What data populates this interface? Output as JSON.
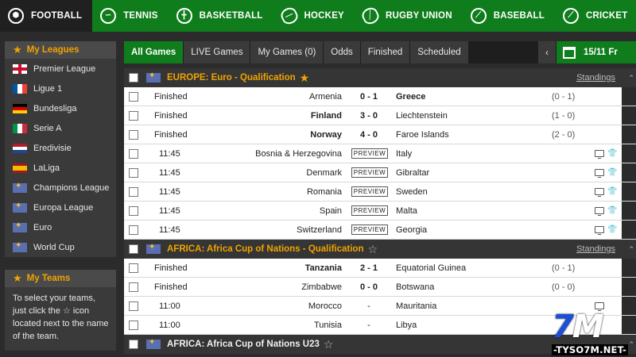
{
  "topnav": {
    "sports": [
      {
        "label": "FOOTBALL",
        "icon": "football-icon",
        "active": true
      },
      {
        "label": "TENNIS",
        "icon": "tennis-icon"
      },
      {
        "label": "BASKETBALL",
        "icon": "basketball-icon"
      },
      {
        "label": "HOCKEY",
        "icon": "hockey-icon"
      },
      {
        "label": "RUGBY UNION",
        "icon": "rugby-icon"
      },
      {
        "label": "BASEBALL",
        "icon": "baseball-icon"
      },
      {
        "label": "CRICKET",
        "icon": "cricket-icon"
      }
    ]
  },
  "sidebar": {
    "leagues_title": "My Leagues",
    "leagues": [
      {
        "label": "Premier League",
        "flag": "eng"
      },
      {
        "label": "Ligue 1",
        "flag": "fra"
      },
      {
        "label": "Bundesliga",
        "flag": "ger"
      },
      {
        "label": "Serie A",
        "flag": "ita"
      },
      {
        "label": "Eredivisie",
        "flag": "ned"
      },
      {
        "label": "LaLiga",
        "flag": "esp"
      },
      {
        "label": "Champions League",
        "flag": "int"
      },
      {
        "label": "Europa League",
        "flag": "int"
      },
      {
        "label": "Euro",
        "flag": "int"
      },
      {
        "label": "World Cup",
        "flag": "int"
      }
    ],
    "teams_title": "My Teams",
    "teams_text_1": "To select your teams, just click the",
    "teams_text_2": "icon located next to the name of the team."
  },
  "tabs": {
    "items": [
      "All Games",
      "LIVE Games",
      "My Games (0)",
      "Odds",
      "Finished",
      "Scheduled"
    ],
    "date": "15/11 Fr"
  },
  "standings_label": "Standings",
  "preview_label": "PREVIEW",
  "competitions": [
    {
      "title": "EUROPE: Euro - Qualification",
      "favorite": true,
      "matches": [
        {
          "status": "Finished",
          "home": "Armenia",
          "score": "0 - 1",
          "away": "Greece",
          "ht": "(0 - 1)",
          "winner": "away"
        },
        {
          "status": "Finished",
          "home": "Finland",
          "score": "3 - 0",
          "away": "Liechtenstein",
          "ht": "(1 - 0)",
          "winner": "home"
        },
        {
          "status": "Finished",
          "home": "Norway",
          "score": "4 - 0",
          "away": "Faroe Islands",
          "ht": "(2 - 0)",
          "winner": "home"
        },
        {
          "time": "11:45",
          "home": "Bosnia & Herzegovina",
          "away": "Italy",
          "preview": true,
          "tv": true
        },
        {
          "time": "11:45",
          "home": "Denmark",
          "away": "Gibraltar",
          "preview": true,
          "tv": true
        },
        {
          "time": "11:45",
          "home": "Romania",
          "away": "Sweden",
          "preview": true,
          "tv": true
        },
        {
          "time": "11:45",
          "home": "Spain",
          "away": "Malta",
          "preview": true,
          "tv": true
        },
        {
          "time": "11:45",
          "home": "Switzerland",
          "away": "Georgia",
          "preview": true,
          "tv": true
        }
      ]
    },
    {
      "title": "AFRICA: Africa Cup of Nations - Qualification",
      "favorite": false,
      "matches": [
        {
          "status": "Finished",
          "home": "Tanzania",
          "score": "2 - 1",
          "away": "Equatorial Guinea",
          "ht": "(0 - 1)",
          "winner": "home"
        },
        {
          "status": "Finished",
          "home": "Zimbabwe",
          "score": "0 - 0",
          "away": "Botswana",
          "ht": "(0 - 0)",
          "winner": "none"
        },
        {
          "time": "11:00",
          "home": "Morocco",
          "score": "-",
          "away": "Mauritania",
          "tv_only": true
        },
        {
          "time": "11:00",
          "home": "Tunisia",
          "score": "-",
          "away": "Libya"
        }
      ]
    },
    {
      "title": "AFRICA: Africa Cup of Nations U23",
      "favorite": false,
      "matches": []
    }
  ],
  "watermark": {
    "mark_a": "7",
    "mark_b": "M",
    "url": "-TYSO7M.NET-"
  }
}
